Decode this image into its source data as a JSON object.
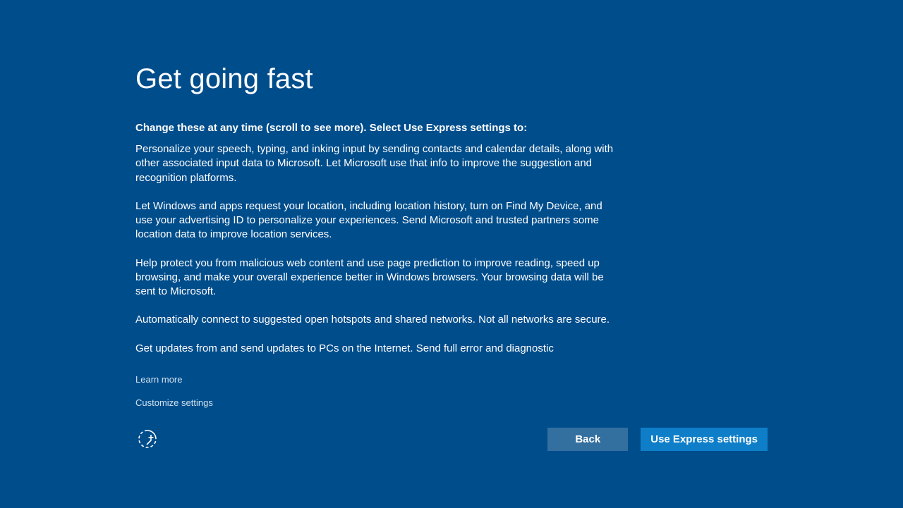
{
  "title": "Get going fast",
  "intro": "Change these at any time (scroll to see more). Select Use Express settings to:",
  "paragraphs": [
    "Personalize your speech, typing, and inking input by sending contacts and calendar details, along with other associated input data to Microsoft. Let Microsoft use that info to improve the suggestion and recognition platforms.",
    "Let Windows and apps request your location, including location history, turn on Find My Device, and use your advertising ID to personalize your experiences. Send Microsoft and trusted partners some location data to improve location services.",
    "Help protect you from malicious web content and use page prediction to improve reading, speed up browsing, and make your overall experience better in Windows browsers. Your browsing data will be sent to Microsoft.",
    "Automatically connect to suggested open hotspots and shared networks. Not all networks are secure.",
    "Get updates from and send updates to PCs on the Internet. Send full error and diagnostic"
  ],
  "links": {
    "learn_more": "Learn more",
    "customize": "Customize settings"
  },
  "buttons": {
    "back": "Back",
    "express": "Use Express settings"
  }
}
